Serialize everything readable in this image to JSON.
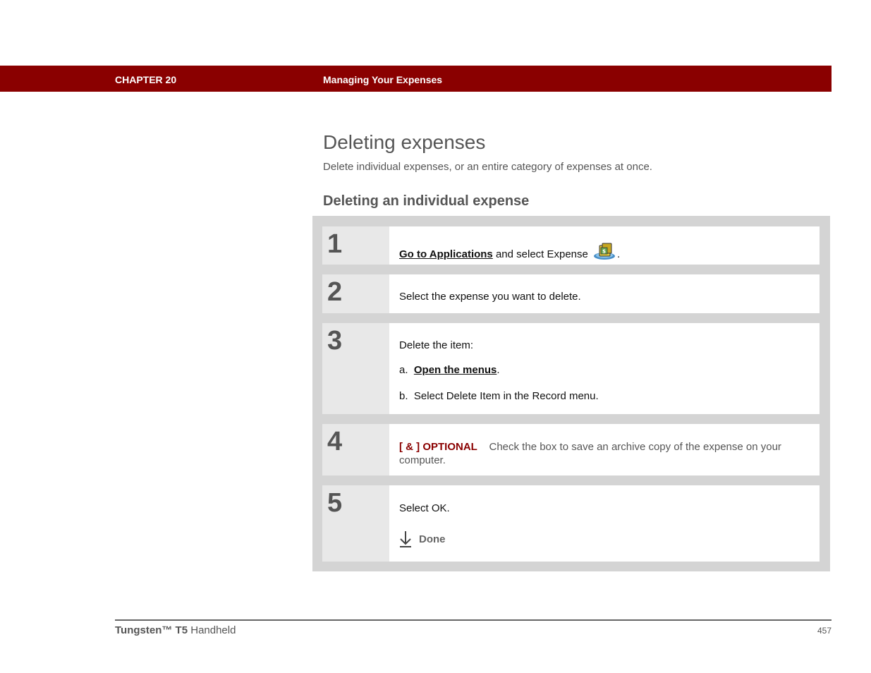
{
  "header": {
    "chapter": "CHAPTER 20",
    "title": "Managing Your Expenses"
  },
  "section": {
    "title": "Deleting expenses",
    "intro": "Delete individual expenses, or an entire category of expenses at once.",
    "subtitle": "Deleting an individual expense"
  },
  "steps": [
    {
      "number": "1",
      "link": "Go to Applications",
      "text": " and select Expense ",
      "icon": "expense-app-icon",
      "suffix": "."
    },
    {
      "number": "2",
      "text": "Select the expense you want to delete."
    },
    {
      "number": "3",
      "text": "Delete the item:",
      "sub_a_prefix": "a.",
      "sub_a_link": "Open the menus",
      "sub_a_suffix": ".",
      "sub_b_prefix": "b.",
      "sub_b_text": "Select Delete Item in the Record menu."
    },
    {
      "number": "4",
      "tag": "[ & ]  OPTIONAL",
      "text": "Check the box to save an archive copy of the expense on your computer."
    },
    {
      "number": "5",
      "text": "Select OK.",
      "done_label": "Done",
      "done_icon": "down-arrow-icon"
    }
  ],
  "footer": {
    "brand": "Tungsten™ T5",
    "product": "Handheld",
    "page": "457"
  },
  "colors": {
    "header_bg": "#8a0000",
    "panel_bg": "#d4d4d4",
    "number_bg": "#e8e8e8",
    "text_gray": "#555555"
  }
}
